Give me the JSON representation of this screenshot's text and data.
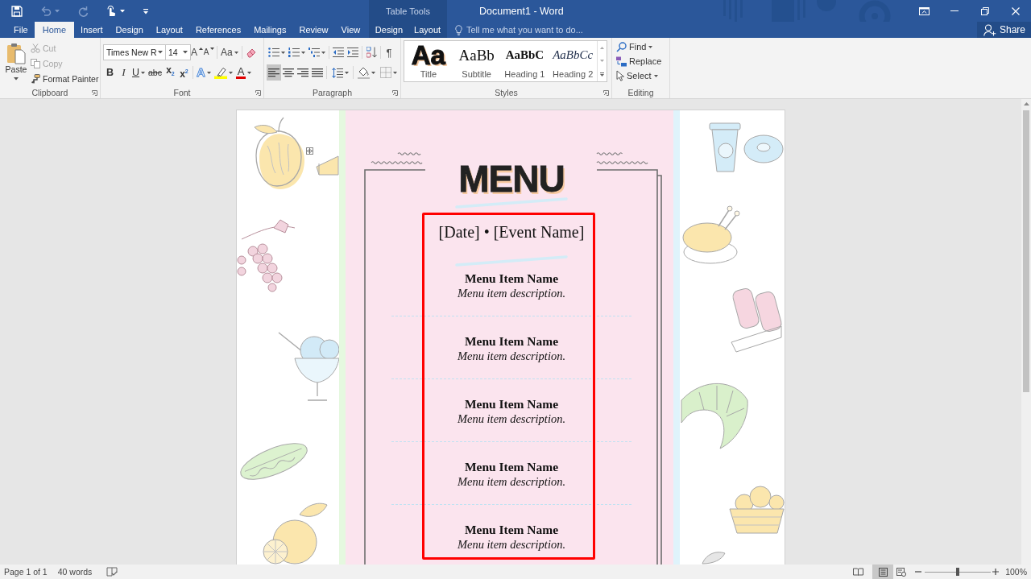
{
  "window": {
    "title": "Document1 - Word"
  },
  "quick_access": [
    {
      "kind": "save",
      "disabled": false,
      "dropdown": false
    },
    {
      "kind": "undo",
      "disabled": true,
      "dropdown": true
    },
    {
      "kind": "redo",
      "disabled": true,
      "dropdown": false
    },
    {
      "kind": "touch",
      "disabled": false,
      "dropdown": true
    },
    {
      "kind": "customize",
      "disabled": false,
      "dropdown": false
    }
  ],
  "contextual_group": {
    "label": "Table Tools"
  },
  "tabs": [
    {
      "label": "File",
      "selected": false,
      "contextual": false
    },
    {
      "label": "Home",
      "selected": true,
      "contextual": false
    },
    {
      "label": "Insert",
      "selected": false,
      "contextual": false
    },
    {
      "label": "Design",
      "selected": false,
      "contextual": false
    },
    {
      "label": "Layout",
      "selected": false,
      "contextual": false
    },
    {
      "label": "References",
      "selected": false,
      "contextual": false
    },
    {
      "label": "Mailings",
      "selected": false,
      "contextual": false
    },
    {
      "label": "Review",
      "selected": false,
      "contextual": false
    },
    {
      "label": "View",
      "selected": false,
      "contextual": false
    },
    {
      "label": "Design",
      "selected": false,
      "contextual": true
    },
    {
      "label": "Layout",
      "selected": false,
      "contextual": true
    }
  ],
  "tell_me": {
    "placeholder": "Tell me what you want to do..."
  },
  "share": {
    "label": "Share"
  },
  "ribbon": {
    "clipboard": {
      "label": "Clipboard",
      "paste": "Paste",
      "items": [
        {
          "kind": "cut",
          "label": "Cut",
          "disabled": true
        },
        {
          "kind": "copy",
          "label": "Copy",
          "disabled": true
        },
        {
          "kind": "format_painter",
          "label": "Format Painter",
          "disabled": false
        }
      ]
    },
    "font": {
      "label": "Font",
      "font_name": "Times New R",
      "font_size": "14",
      "size_buttons": [
        {
          "kind": "grow",
          "label": "A"
        },
        {
          "kind": "shrink",
          "label": "A"
        }
      ],
      "case_label": "Aa",
      "format_buttons": [
        {
          "kind": "bold",
          "label": "B",
          "dropdown": false
        },
        {
          "kind": "italic",
          "label": "I",
          "dropdown": false
        },
        {
          "kind": "underline",
          "label": "U",
          "dropdown": true
        },
        {
          "kind": "strike",
          "label": "abc",
          "dropdown": false
        },
        {
          "kind": "subscript",
          "label": "x$_{2}$",
          "dropdown": false
        },
        {
          "kind": "superscript",
          "label": "x$^{2}$",
          "dropdown": false
        }
      ],
      "effects_label": "A",
      "color_label": "A"
    },
    "paragraph": {
      "label": "Paragraph",
      "marks_label": "¶",
      "alignment": [
        {
          "kind": "left",
          "selected": true
        },
        {
          "kind": "center",
          "selected": false
        },
        {
          "kind": "right",
          "selected": false
        },
        {
          "kind": "justify",
          "selected": false
        }
      ]
    },
    "styles": {
      "label": "Styles",
      "gallery": [
        {
          "kind": "title",
          "preview": "Aa",
          "name": "Title"
        },
        {
          "kind": "subtitle",
          "preview": "AaBb",
          "name": "Subtitle"
        },
        {
          "kind": "heading1",
          "preview": "AaBbC",
          "name": "Heading 1"
        },
        {
          "kind": "heading2",
          "preview": "AaBbCc",
          "name": "Heading 2"
        }
      ]
    },
    "editing": {
      "label": "Editing",
      "items": [
        {
          "kind": "find",
          "label": "Find",
          "dropdown": true
        },
        {
          "kind": "replace",
          "label": "Replace",
          "dropdown": false
        },
        {
          "kind": "select",
          "label": "Select",
          "dropdown": true
        }
      ]
    }
  },
  "document": {
    "title": "MENU",
    "subtitle": "[Date] • [Event Name]",
    "items": [
      {
        "name": "Menu Item Name",
        "description": "Menu item description."
      },
      {
        "name": "Menu Item Name",
        "description": "Menu item description."
      },
      {
        "name": "Menu Item Name",
        "description": "Menu item description."
      },
      {
        "name": "Menu Item Name",
        "description": "Menu item description."
      },
      {
        "name": "Menu Item Name",
        "description": "Menu item description."
      }
    ]
  },
  "status_bar": {
    "page": "Page 1 of 1",
    "words": "40 words",
    "views": [
      {
        "kind": "read",
        "selected": false
      },
      {
        "kind": "print",
        "selected": true
      },
      {
        "kind": "web",
        "selected": false
      }
    ],
    "zoom": {
      "level": 0.5,
      "reading": "100%"
    }
  }
}
